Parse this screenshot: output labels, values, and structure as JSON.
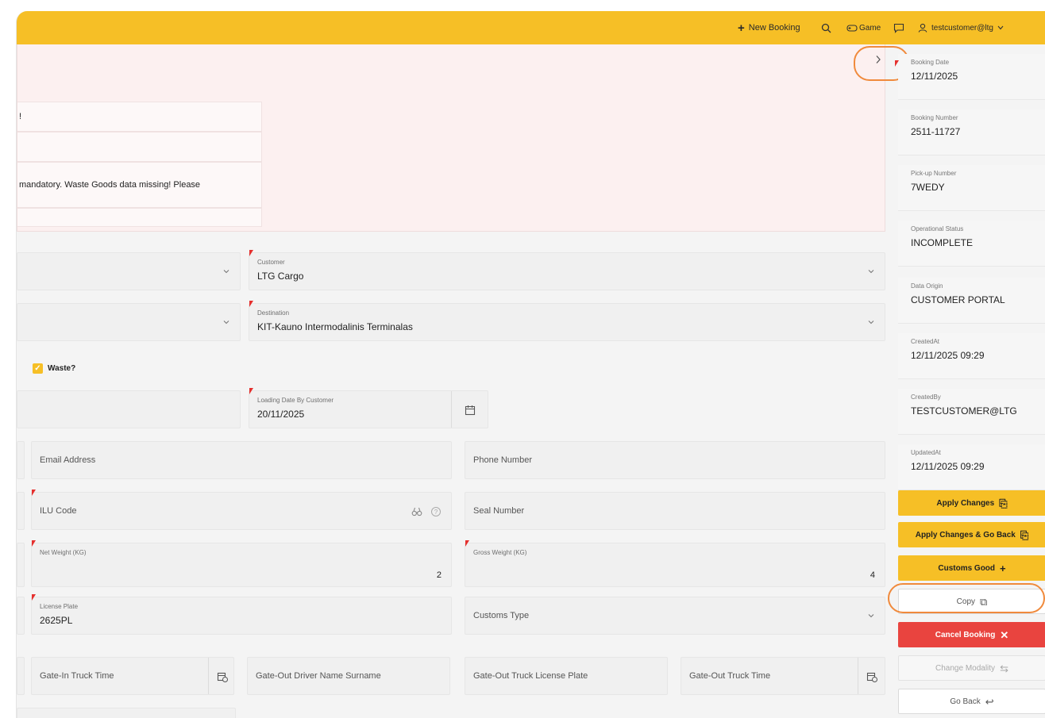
{
  "topbar": {
    "new_booking": "New Booking",
    "game": "Game",
    "user": "testcustomer@ltg"
  },
  "alert": {
    "row1": "!",
    "row2": "",
    "row3": "mandatory. Waste Goods data missing! Please",
    "row4": ""
  },
  "form": {
    "customer_label": "Customer",
    "customer_value": "LTG Cargo",
    "destination_label": "Destination",
    "destination_value": "KIT-Kauno Intermodalinis Terminalas",
    "waste_label": "Waste?",
    "loading_date_label": "Loading Date By Customer",
    "loading_date_value": "20/11/2025",
    "email_placeholder": "Email Address",
    "phone_placeholder": "Phone Number",
    "ilu_placeholder": "ILU Code",
    "seal_placeholder": "Seal Number",
    "net_weight_label": "Net Weight (KG)",
    "net_weight_value": "2",
    "gross_weight_label": "Gross Weight (KG)",
    "gross_weight_value": "4",
    "license_plate_label": "License Plate",
    "license_plate_value": "2625PL",
    "customs_type_placeholder": "Customs Type",
    "gate_in_truck_time": "Gate-In Truck Time",
    "gate_out_driver": "Gate-Out Driver Name Surname",
    "gate_out_plate": "Gate-Out Truck License Plate",
    "gate_out_time": "Gate-Out Truck Time"
  },
  "side": {
    "info": [
      {
        "label": "Booking Date",
        "value": "12/11/2025"
      },
      {
        "label": "Booking Number",
        "value": "2511-11727"
      },
      {
        "label": "Pick-up Number",
        "value": "7WEDY"
      },
      {
        "label": "Operational Status",
        "value": "INCOMPLETE"
      },
      {
        "label": "Data Origin",
        "value": "CUSTOMER PORTAL"
      },
      {
        "label": "CreatedAt",
        "value": "12/11/2025 09:29"
      },
      {
        "label": "CreatedBy",
        "value": "TESTCUSTOMER@LTG"
      },
      {
        "label": "UpdatedAt",
        "value": "12/11/2025 09:29"
      }
    ],
    "buttons": {
      "apply": "Apply Changes",
      "apply_back": "Apply Changes & Go Back",
      "customs": "Customs Good",
      "copy": "Copy",
      "cancel": "Cancel Booking",
      "change_modality": "Change Modality",
      "go_back": "Go Back"
    }
  },
  "colors": {
    "accent": "#f6bf26",
    "danger": "#e9443f",
    "callout": "#f08a3c",
    "required": "#e5302e"
  }
}
